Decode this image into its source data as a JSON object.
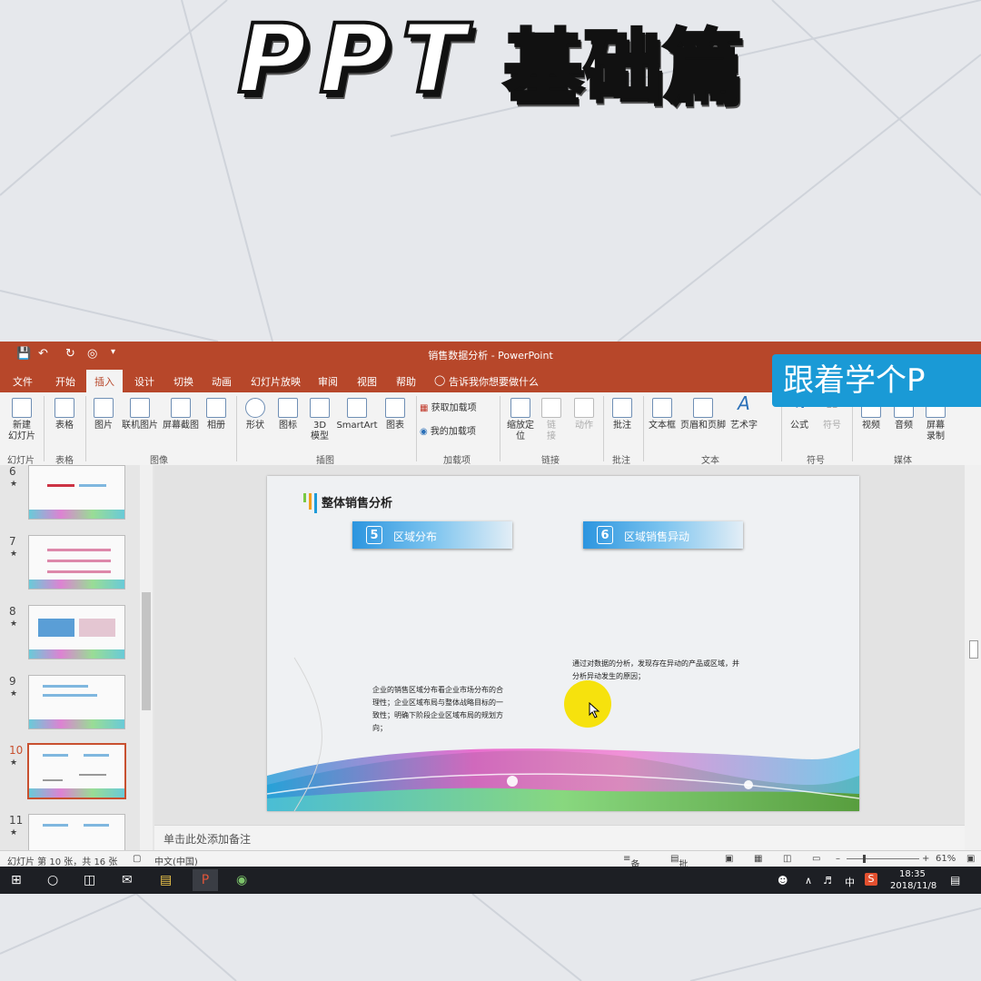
{
  "headline": {
    "latin": "PPT",
    "cn": "基础篇"
  },
  "promo_banner": "跟着学个P",
  "titlebar": {
    "title": "销售数据分析 - PowerPoint"
  },
  "tabs": [
    "文件",
    "开始",
    "插入",
    "设计",
    "切换",
    "动画",
    "幻灯片放映",
    "审阅",
    "视图",
    "帮助"
  ],
  "active_tab": "插入",
  "tell_me": "告诉我你想要做什么",
  "ribbon": {
    "new_slide": "新建\n幻灯片",
    "table": "表格",
    "picture": "图片",
    "online_picture": "联机图片",
    "screenshot": "屏幕截图",
    "album": "相册",
    "shapes": "形状",
    "icons": "图标",
    "model3d": "3D\n模型",
    "smartart": "SmartArt",
    "chart": "图表",
    "get_addins": "获取加载项",
    "my_addins": "我的加载项",
    "zoom": "缩放定\n位",
    "link": "链\n接",
    "action": "动作",
    "comment": "批注",
    "textbox": "文本框",
    "header_footer": "页眉和页脚",
    "wordart": "艺术字",
    "equation": "公式",
    "symbol": "符号",
    "video": "视频",
    "audio": "音频",
    "screen_record": "屏幕\n录制",
    "groups": {
      "slides": "幻灯片",
      "tables": "表格",
      "images": "图像",
      "illustrations": "插图",
      "addins": "加载项",
      "links": "链接",
      "comments": "批注",
      "text": "文本",
      "symbols": "符号",
      "media": "媒体"
    }
  },
  "thumbnails": [
    {
      "num": "6"
    },
    {
      "num": "7"
    },
    {
      "num": "8"
    },
    {
      "num": "9"
    },
    {
      "num": "10",
      "selected": true
    },
    {
      "num": "11"
    }
  ],
  "slide": {
    "title": "整体销售分析",
    "box1": {
      "num": "5",
      "label": "区域分布"
    },
    "box2": {
      "num": "6",
      "label": "区域销售异动"
    },
    "text_left": "企业的销售区域分布看企业市场分布的合理性；企业区域布局与整体战略目标的一致性；明确下阶段企业区域布局的规划方向；",
    "text_right": "通过对数据的分析，发现存在异动的产品或区域，并分析异动发生的原因；"
  },
  "notes_placeholder": "单击此处添加备注",
  "status": {
    "slide_info": "幻灯片 第 10 张，共 16 张",
    "language": "中文(中国)",
    "notes": "备注",
    "comments": "批注",
    "zoom": "61%"
  },
  "taskbar": {
    "ime": "中",
    "time": "18:35",
    "date": "2018/11/8"
  },
  "colors": {
    "accent": "#b7472a",
    "promo": "#1a9ad6",
    "highlight": "#f5e000"
  }
}
